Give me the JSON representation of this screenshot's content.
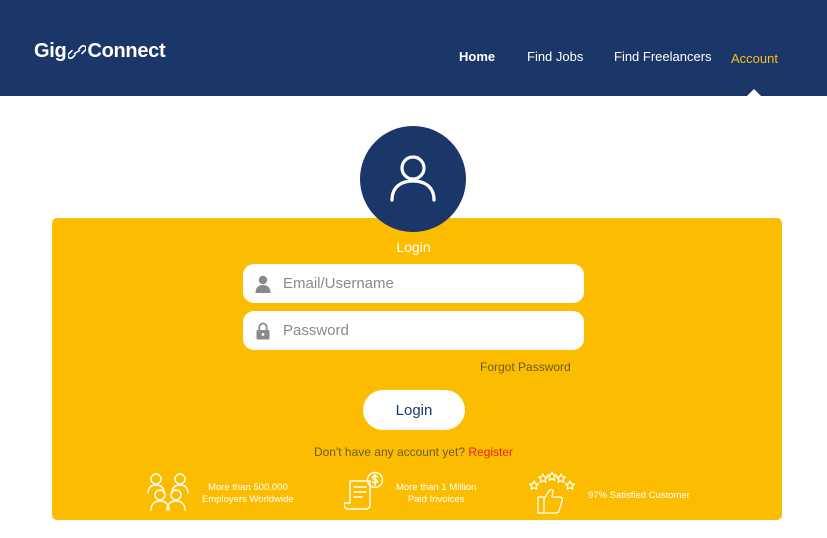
{
  "header": {
    "logo_left": "Gig",
    "logo_right": "Connect",
    "nav": {
      "home": "Home",
      "find_jobs": "Find Jobs",
      "find_freelancers": "Find Freelancers",
      "account": "Account"
    }
  },
  "login": {
    "title": "Login",
    "email_placeholder": "Email/Username",
    "password_placeholder": "Password",
    "forgot_password": "Forgot Password",
    "button": "Login",
    "no_account_text": "Don't have any account yet?",
    "register_link": "Register"
  },
  "stats": [
    {
      "icon": "people-icon",
      "line1": "More than 500.000",
      "line2": "Employers Worldwide"
    },
    {
      "icon": "invoice-icon",
      "line1": "More than 1 Million",
      "line2": "Paid Invoices"
    },
    {
      "icon": "satisfaction-icon",
      "line1": "97% Satisfied Customer",
      "line2": ""
    }
  ],
  "colors": {
    "navy": "#1b3668",
    "yellow": "#fcbd00",
    "accent_account": "#f7bc1b",
    "register_red": "#e8261f"
  }
}
